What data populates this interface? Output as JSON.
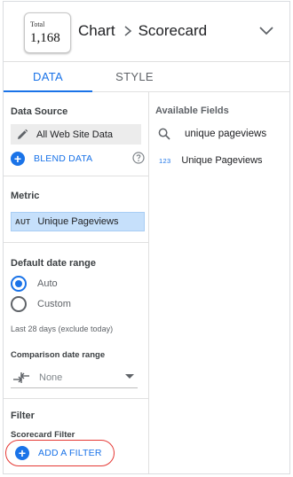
{
  "header": {
    "thumbnail": {
      "label": "Total",
      "value": "1,168"
    },
    "crumb_parent": "Chart",
    "crumb_current": "Scorecard"
  },
  "tabs": [
    {
      "label": "DATA",
      "active": true
    },
    {
      "label": "STYLE",
      "active": false
    }
  ],
  "data_source": {
    "title": "Data Source",
    "name": "All Web Site Data",
    "blend_label": "BLEND DATA"
  },
  "metric": {
    "title": "Metric",
    "type_badge": "AUT",
    "name": "Unique Pageviews"
  },
  "date_range": {
    "title": "Default date range",
    "options": [
      {
        "label": "Auto",
        "selected": true
      },
      {
        "label": "Custom",
        "selected": false
      }
    ],
    "note": "Last 28 days (exclude today)",
    "comparison_title": "Comparison date range",
    "comparison_value": "None"
  },
  "filter": {
    "title": "Filter",
    "subtitle": "Scorecard Filter",
    "add_label": "ADD A FILTER"
  },
  "available_fields": {
    "title": "Available Fields",
    "search_value": "unique pageviews",
    "items": [
      {
        "type_badge": "123",
        "label": "Unique Pageviews"
      }
    ]
  },
  "colors": {
    "accent": "#1a73e8",
    "metric_bg": "#c6e0fb",
    "highlight_ring": "#e53935"
  }
}
